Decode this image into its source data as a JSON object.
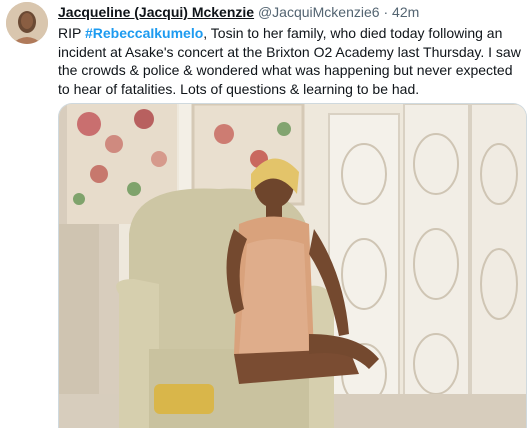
{
  "tweet": {
    "display_name": "Jacqueline (Jacqui) Mckenzie",
    "handle": "@JacquiMckenzie6",
    "separator": "·",
    "time": "42m",
    "text_prefix": "RIP ",
    "hashtag": "#RebeccaIkumelo",
    "text_rest": ", Tosin to her family, who died today following an incident at Asake's concert at the Brixton O2 Academy last Thursday. I saw the crowds & police & wondered what was happening but never expected to hear of fatalities. Lots of questions & learning to be had."
  },
  "colors": {
    "link": "#1d9bf0",
    "secondary_text": "#536471",
    "primary_text": "#0f1419"
  }
}
